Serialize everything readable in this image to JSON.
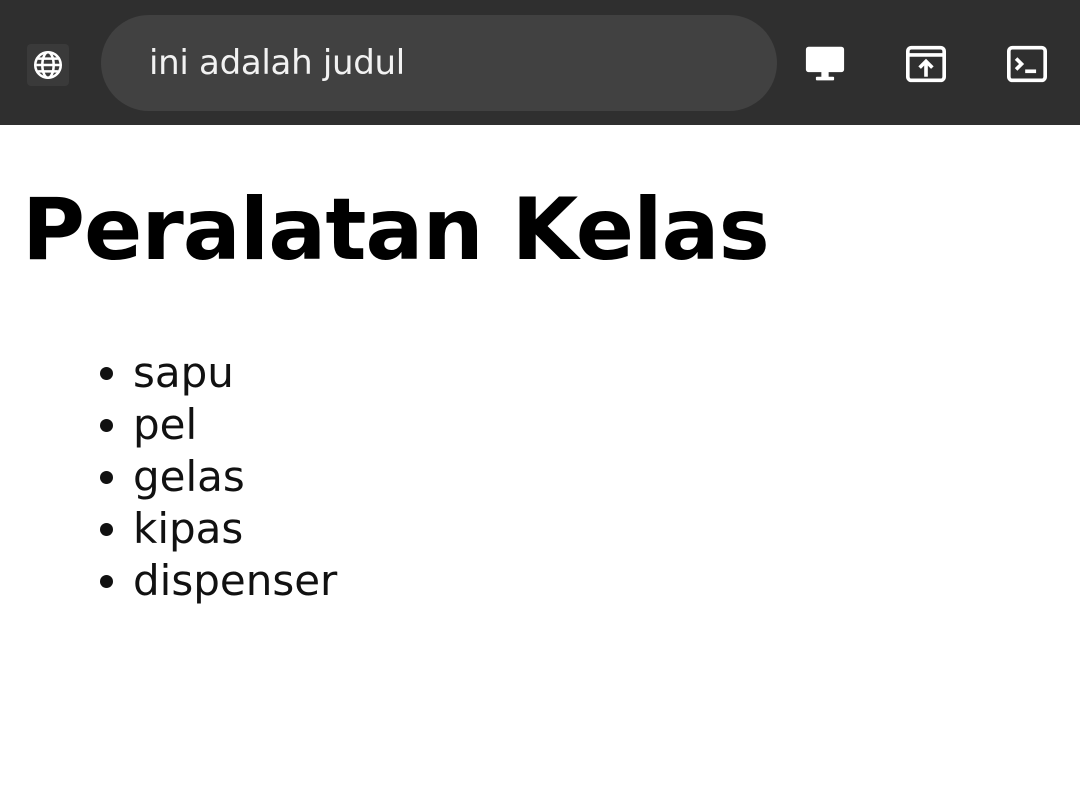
{
  "browser": {
    "address_text": "ini adalah judul",
    "icons": {
      "site": "globe-icon",
      "desktop": "desktop-icon",
      "open_external": "open-in-new-icon",
      "console": "terminal-icon"
    }
  },
  "page": {
    "heading": "Peralatan Kelas",
    "items": [
      "sapu",
      "pel",
      "gelas",
      "kipas",
      "dispenser"
    ]
  }
}
